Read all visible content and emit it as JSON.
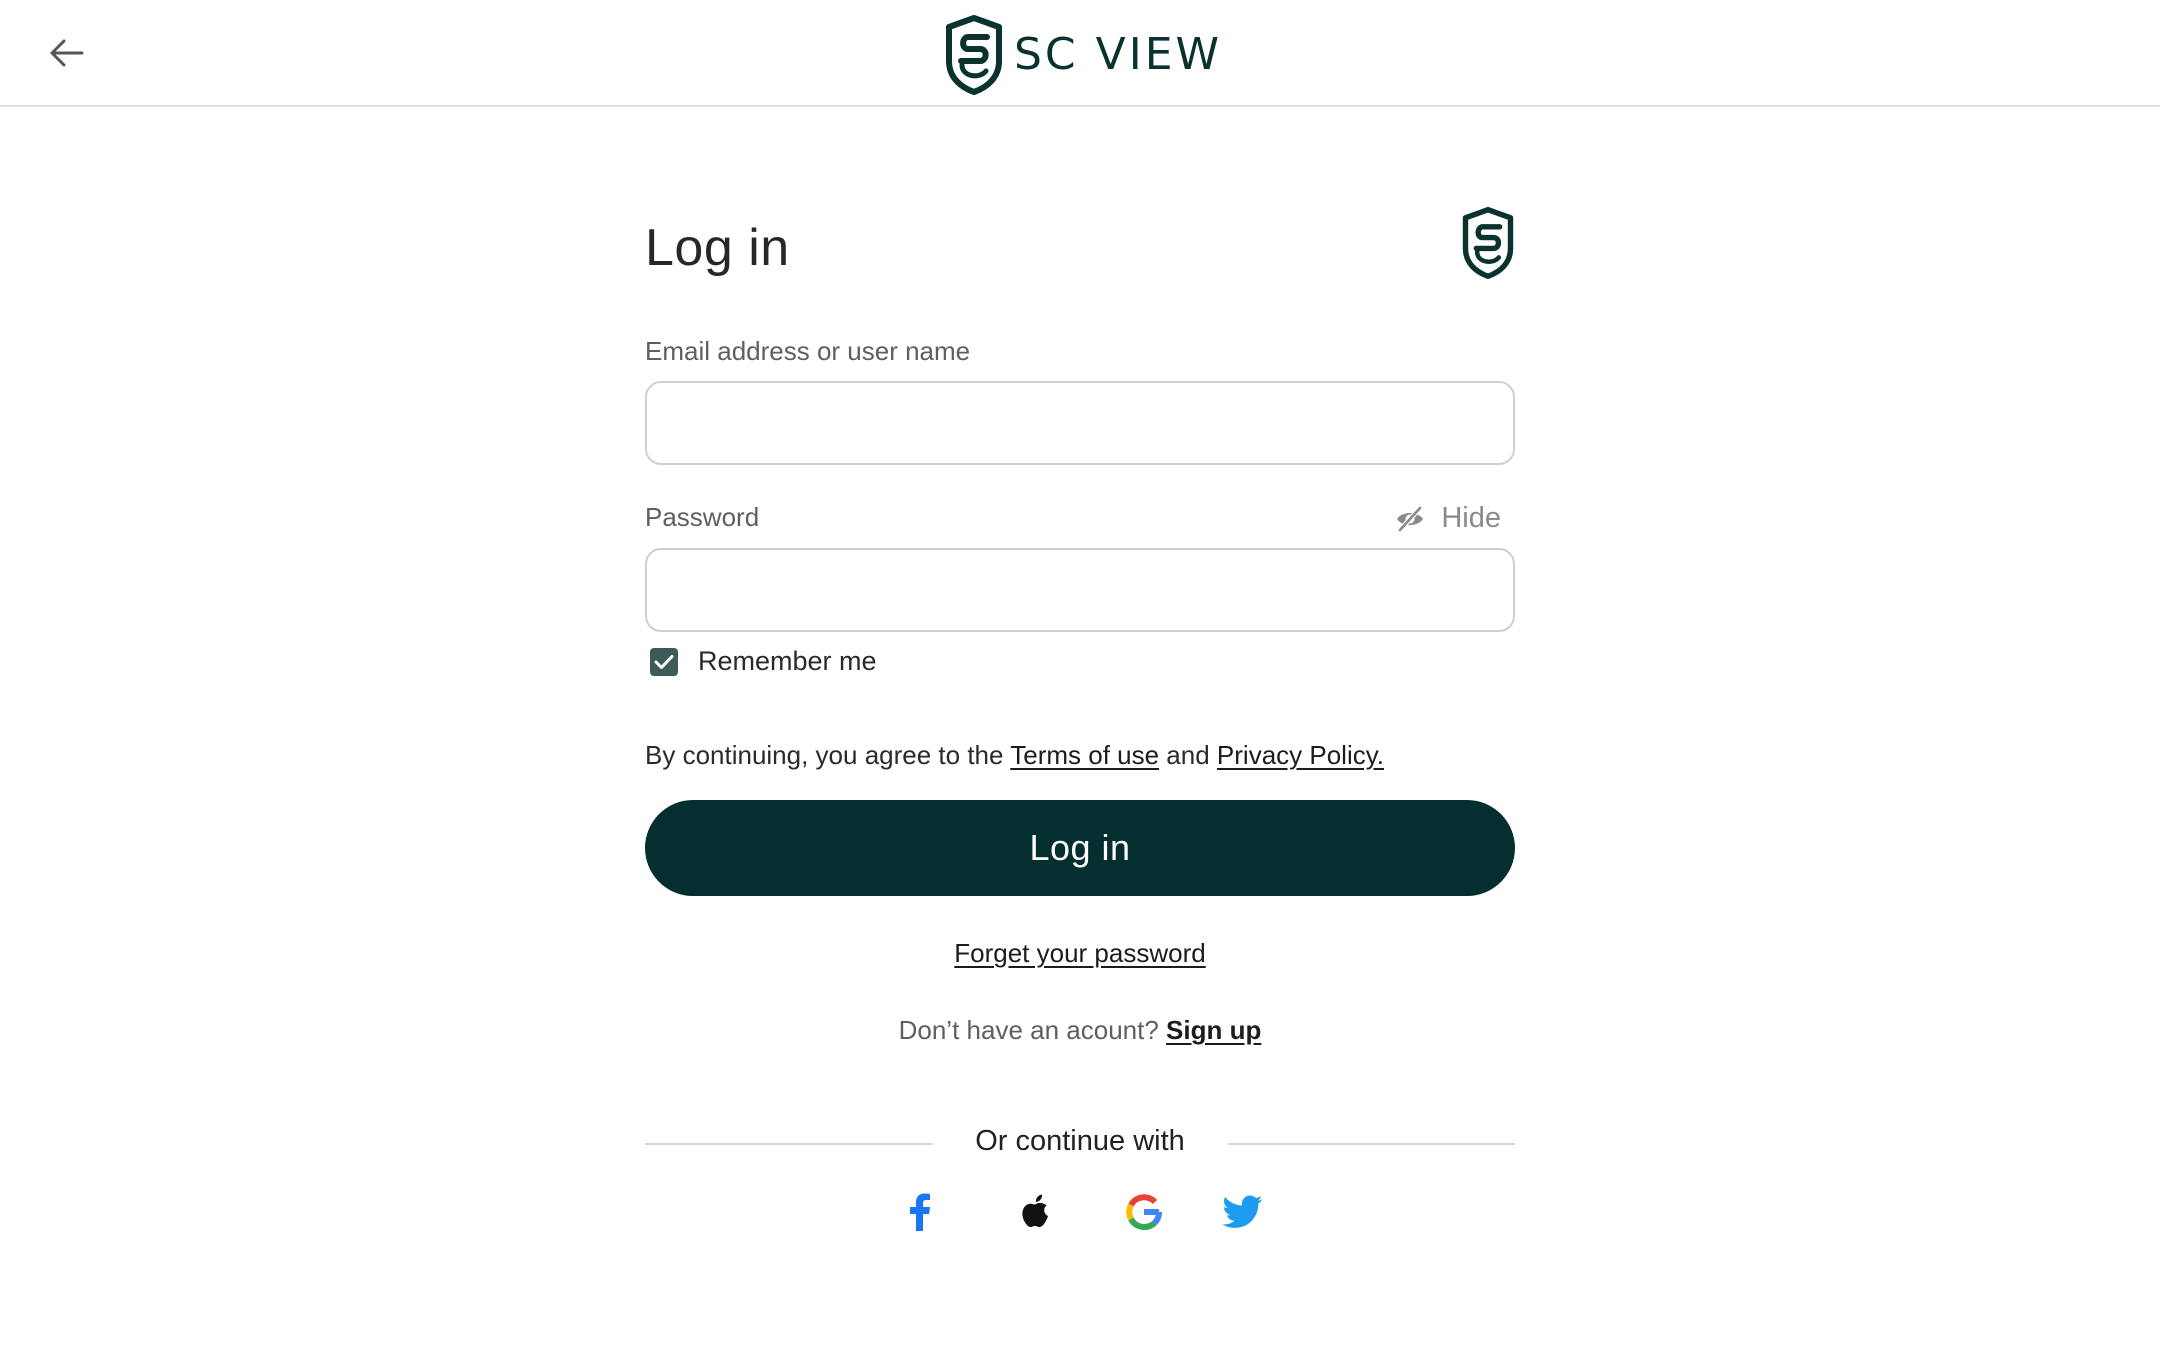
{
  "header": {
    "back_label": "Back",
    "brand_name": "SC VIEW"
  },
  "form": {
    "title": "Log in",
    "email_label": "Email address or user name",
    "email_value": "",
    "email_placeholder": "",
    "password_label": "Password",
    "password_value": "",
    "password_placeholder": "",
    "hide_label": "Hide",
    "remember_label": "Remember me",
    "remember_checked": true,
    "agree_prefix": "By continuing, you agree to the",
    "terms_label": "Terms of use",
    "agree_and": "and",
    "privacy_label": "Privacy Policy.",
    "login_button": "Log in",
    "forgot_label": "Forget your password",
    "no_account_text": "Don’t have an acount?",
    "signup_label": "Sign up",
    "continue_with": "Or continue with"
  },
  "social": [
    {
      "name": "facebook",
      "icon": "facebook-icon",
      "color": "#1877f2"
    },
    {
      "name": "apple",
      "icon": "apple-icon",
      "color": "#111111"
    },
    {
      "name": "google",
      "icon": "google-icon",
      "color": "#4285f4"
    },
    {
      "name": "twitter",
      "icon": "twitter-icon",
      "color": "#1d9bf0"
    }
  ],
  "colors": {
    "brand_dark": "#052f2e",
    "logo": "#0a3330",
    "checkbox": "#3c5a57",
    "input_border": "#cfcfcf",
    "muted_text": "#5f5f5f"
  }
}
